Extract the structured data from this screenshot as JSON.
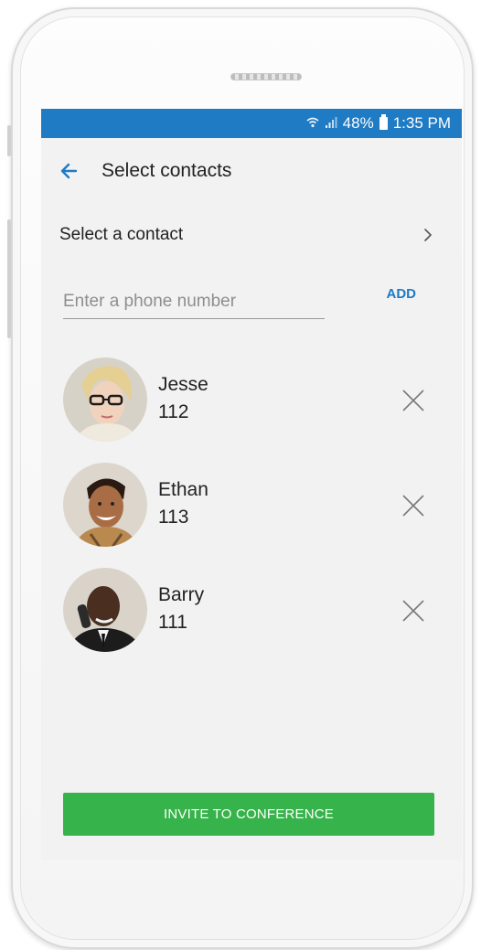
{
  "status_bar": {
    "battery": "48%",
    "time": "1:35 PM",
    "icons": [
      "wifi-icon",
      "signal-icon",
      "battery-icon"
    ]
  },
  "header": {
    "title": "Select contacts",
    "back_icon": "arrow-left-icon"
  },
  "select_contact": {
    "label": "Select a contact",
    "icon": "chevron-right-icon"
  },
  "phone_entry": {
    "placeholder": "Enter a phone number",
    "value": "",
    "add_label": "ADD"
  },
  "contacts": [
    {
      "name": "Jesse",
      "number": "112"
    },
    {
      "name": "Ethan",
      "number": "113"
    },
    {
      "name": "Barry",
      "number": "111"
    }
  ],
  "invite_button": {
    "label": "INVITE TO CONFERENCE"
  },
  "colors": {
    "status_bar": "#1e7bc4",
    "accent": "#1e7bc4",
    "invite": "#36b34a"
  }
}
